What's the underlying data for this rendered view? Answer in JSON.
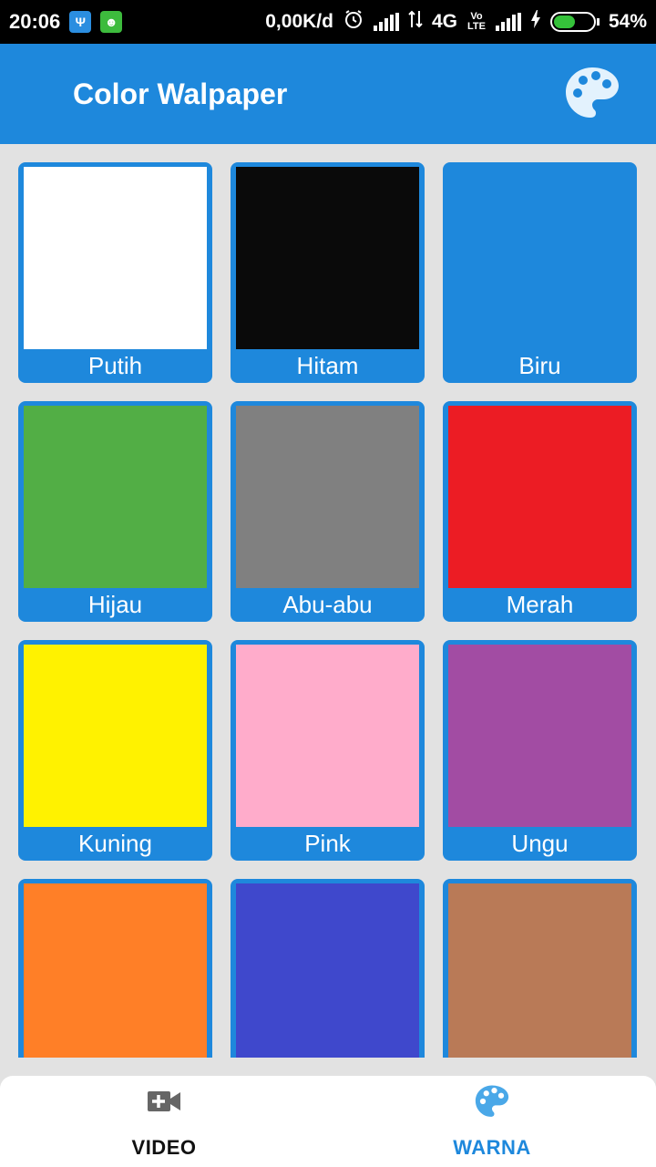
{
  "status_bar": {
    "time": "20:06",
    "net_speed": "0,00K/d",
    "network": "4G",
    "volte": "Vo LTE",
    "battery_percent": "54%",
    "battery_level": 0.54,
    "icons": [
      "usb-icon",
      "android-icon",
      "alarm-icon",
      "signal-icon",
      "data-arrows-icon",
      "volte-icon",
      "signal-icon",
      "charging-icon",
      "battery-icon"
    ]
  },
  "app_bar": {
    "title": "Color Walpaper",
    "action_icon": "palette-icon"
  },
  "colors": [
    {
      "name": "Putih",
      "hex": "#ffffff"
    },
    {
      "name": "Hitam",
      "hex": "#0a0a0a"
    },
    {
      "name": "Biru",
      "hex": "#1e88dc"
    },
    {
      "name": "Hijau",
      "hex": "#52ae45"
    },
    {
      "name": "Abu-abu",
      "hex": "#808080"
    },
    {
      "name": "Merah",
      "hex": "#ec1c24"
    },
    {
      "name": "Kuning",
      "hex": "#fff200"
    },
    {
      "name": "Pink",
      "hex": "#ffaccb"
    },
    {
      "name": "Ungu",
      "hex": "#a24ca3"
    },
    {
      "name": "",
      "hex": "#ff7f27"
    },
    {
      "name": "",
      "hex": "#3f48cc"
    },
    {
      "name": "",
      "hex": "#b97a57"
    }
  ],
  "bottom_nav": {
    "items": [
      {
        "label": "VIDEO",
        "icon": "video-add-icon",
        "active": false
      },
      {
        "label": "WARNA",
        "icon": "palette-icon",
        "active": true
      }
    ],
    "active_color": "#1e88dc"
  }
}
